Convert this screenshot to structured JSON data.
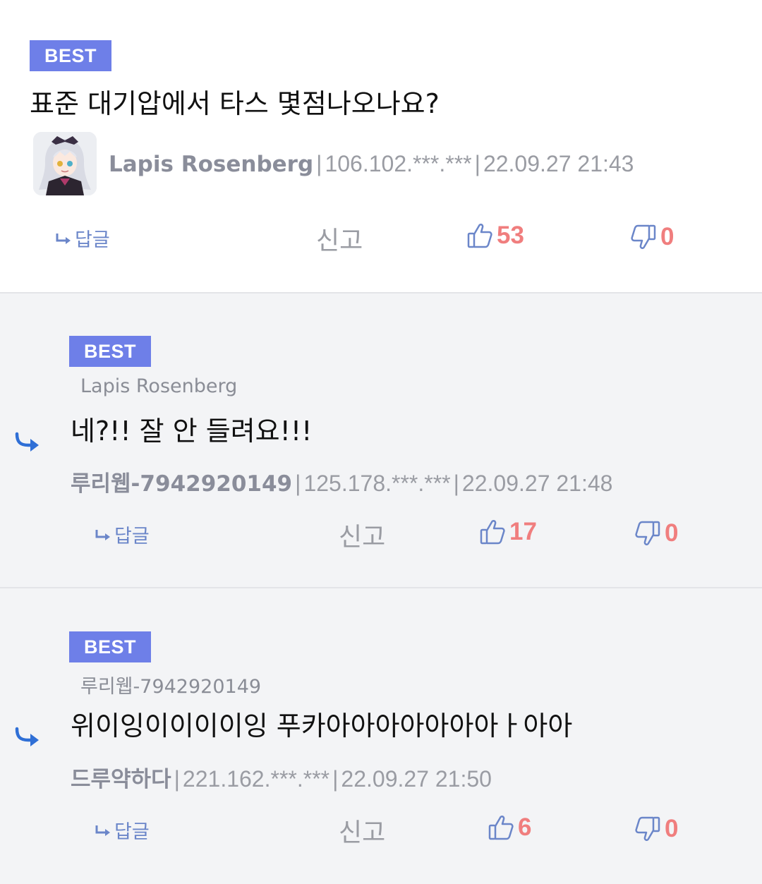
{
  "comments": [
    {
      "badge": "BEST",
      "title": "표준 대기압에서 타스 몇점나오나요?",
      "author": "Lapis Rosenberg",
      "ip": "106.102.***.***",
      "datetime": "22.09.27 21:43",
      "reply_label": "답글",
      "report_label": "신고",
      "likes": "53",
      "dislikes": "0"
    },
    {
      "badge": "BEST",
      "reply_to": "Lapis Rosenberg",
      "title": "네?!! 잘 안 들려요!!!",
      "author": "루리웹-7942920149",
      "ip": "125.178.***.***",
      "datetime": "22.09.27 21:48",
      "reply_label": "답글",
      "report_label": "신고",
      "likes": "17",
      "dislikes": "0"
    },
    {
      "badge": "BEST",
      "reply_to": "루리웹-7942920149",
      "title": "위이잉이이이이잉 푸카아아아아아아아ㅏ아아",
      "author": "드루약하다",
      "ip": "221.162.***.***",
      "datetime": "22.09.27 21:50",
      "reply_label": "답글",
      "report_label": "신고",
      "likes": "6",
      "dislikes": "0"
    }
  ],
  "separator": "|",
  "colors": {
    "badge": "#6e7fe8",
    "vote_count": "#f07e7e",
    "thumb_icon": "#6b86c9",
    "reply_arrow": "#2f6fd6",
    "reply_bg": "#f3f4f6"
  },
  "icons": {
    "reply": "reply-arrow-icon",
    "like": "thumbs-up-icon",
    "dislike": "thumbs-down-icon",
    "nested": "nested-reply-arrow-icon"
  }
}
